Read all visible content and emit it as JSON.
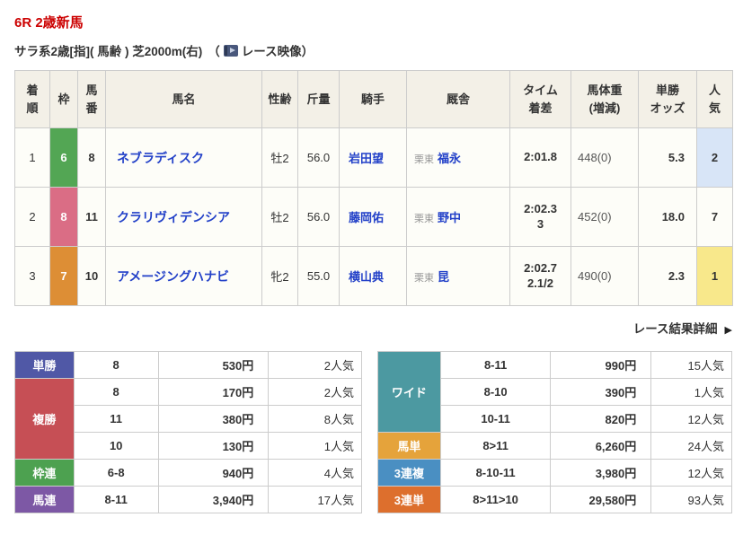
{
  "header": {
    "title": "6R 2歳新馬",
    "conditions": "サラ系2歳[指]( 馬齢 ) 芝2000m(右)",
    "paren_open": "（",
    "video_label": "レース映像",
    "paren_close": "）"
  },
  "results": {
    "headers": [
      "着\n順",
      "枠",
      "馬\n番",
      "馬名",
      "性齢",
      "斤量",
      "騎手",
      "厩舎",
      "タイム\n着差",
      "馬体重\n(増減)",
      "単勝\nオッズ",
      "人\n気"
    ],
    "rows": [
      {
        "rank": "1",
        "frame": "6",
        "frame_color": "#53a654",
        "horse_no": "8",
        "horse_name": "ネブラディスク",
        "sex_age": "牡2",
        "weight": "56.0",
        "jockey": "岩田望",
        "stable_region": "栗東",
        "trainer": "福永",
        "time_margin": "2:01.8",
        "body_weight": "448(0)",
        "odds": "5.3",
        "ninki": "2",
        "ninki_bg": "#d8e5f7"
      },
      {
        "rank": "2",
        "frame": "8",
        "frame_color": "#da6d85",
        "horse_no": "11",
        "horse_name": "クラリヴィデンシア",
        "sex_age": "牡2",
        "weight": "56.0",
        "jockey": "藤岡佑",
        "stable_region": "栗東",
        "trainer": "野中",
        "time_margin": "2:02.3\n3",
        "body_weight": "452(0)",
        "odds": "18.0",
        "ninki": "7",
        "ninki_bg": ""
      },
      {
        "rank": "3",
        "frame": "7",
        "frame_color": "#dd8e35",
        "horse_no": "10",
        "horse_name": "アメージングハナビ",
        "sex_age": "牝2",
        "weight": "55.0",
        "jockey": "横山典",
        "stable_region": "栗東",
        "trainer": "昆",
        "time_margin": "2:02.7\n2.1/2",
        "body_weight": "490(0)",
        "odds": "2.3",
        "ninki": "1",
        "ninki_bg": "#f8e88b"
      }
    ]
  },
  "detail_link": {
    "label": "レース結果詳細",
    "arrow": "▶"
  },
  "payouts": {
    "left": [
      {
        "label": "単勝",
        "color": "#5058a6",
        "rows": [
          {
            "sel": "8",
            "amount": "530円",
            "ninki": "2人気"
          }
        ]
      },
      {
        "label": "複勝",
        "color": "#c64f55",
        "rows": [
          {
            "sel": "8",
            "amount": "170円",
            "ninki": "2人気"
          },
          {
            "sel": "11",
            "amount": "380円",
            "ninki": "8人気"
          },
          {
            "sel": "10",
            "amount": "130円",
            "ninki": "1人気"
          }
        ]
      },
      {
        "label": "枠連",
        "color": "#4da150",
        "rows": [
          {
            "sel": "6-8",
            "amount": "940円",
            "ninki": "4人気"
          }
        ]
      },
      {
        "label": "馬連",
        "color": "#7d58a5",
        "rows": [
          {
            "sel": "8-11",
            "amount": "3,940円",
            "ninki": "17人気"
          }
        ]
      }
    ],
    "right": [
      {
        "label": "ワイド",
        "color": "#4c99a1",
        "rows": [
          {
            "sel": "8-11",
            "amount": "990円",
            "ninki": "15人気"
          },
          {
            "sel": "8-10",
            "amount": "390円",
            "ninki": "1人気"
          },
          {
            "sel": "10-11",
            "amount": "820円",
            "ninki": "12人気"
          }
        ]
      },
      {
        "label": "馬単",
        "color": "#e5a33b",
        "rows": [
          {
            "sel": "8>11",
            "amount": "6,260円",
            "ninki": "24人気"
          }
        ]
      },
      {
        "label": "3連複",
        "color": "#4a8fc2",
        "rows": [
          {
            "sel": "8-10-11",
            "amount": "3,980円",
            "ninki": "12人気"
          }
        ]
      },
      {
        "label": "3連単",
        "color": "#dd6f2d",
        "rows": [
          {
            "sel": "8>11>10",
            "amount": "29,580円",
            "ninki": "93人気"
          }
        ]
      }
    ]
  }
}
